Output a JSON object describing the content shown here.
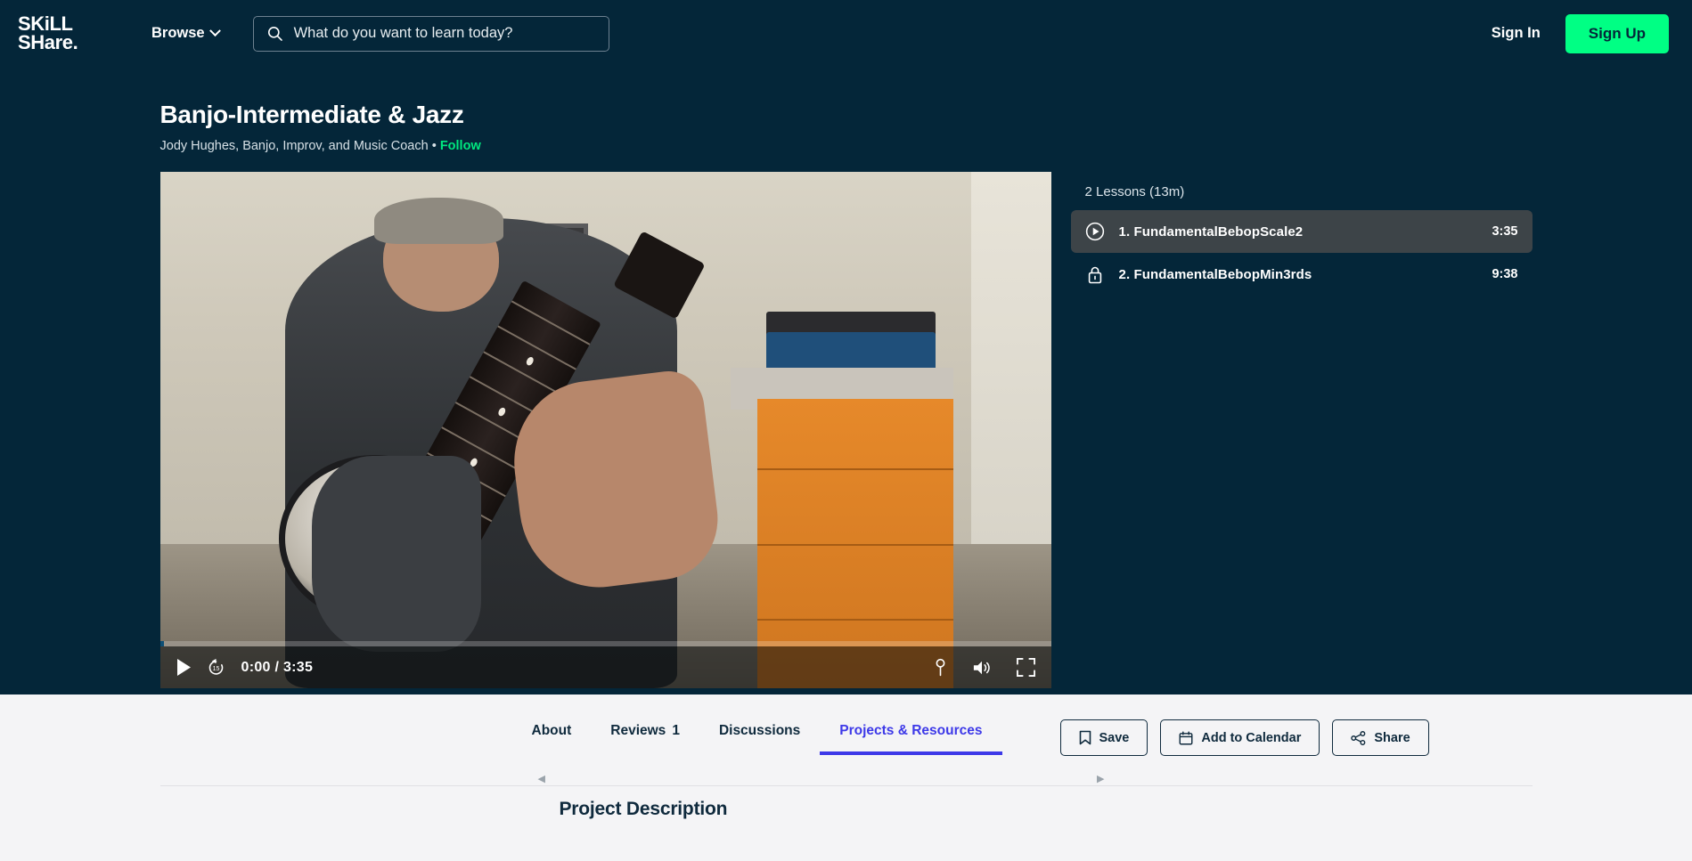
{
  "header": {
    "logo_line1": "SKiLL",
    "logo_line2": "SHare.",
    "browse_label": "Browse",
    "browse_icon": "chevron-down-icon",
    "search_icon": "search-icon",
    "search_placeholder": "What do you want to learn today?",
    "search_value": "",
    "sign_in_label": "Sign In",
    "sign_up_label": "Sign Up",
    "background_color": "#042639",
    "accent_green": "#00FF84"
  },
  "course": {
    "title": "Banjo-Intermediate & Jazz",
    "byline_author": "Jody Hughes, Banjo, Improv, and Music Coach",
    "byline_separator": "•",
    "follow_label": "Follow",
    "follow_color": "#00E87F"
  },
  "player": {
    "play_icon": "play-icon",
    "rewind_icon": "rewind-15-icon",
    "time_display": "0:00 / 3:35",
    "current_time": "0:00",
    "total_time": "3:35",
    "progress_percent": 0,
    "cc_icon": "pin-icon",
    "volume_icon": "volume-icon",
    "fullscreen_icon": "fullscreen-icon"
  },
  "lessons": {
    "summary": "2 Lessons (13m)",
    "items": [
      {
        "icon": "play-circle-icon",
        "title": "1. FundamentalBebopScale2",
        "duration": "3:35",
        "active": true
      },
      {
        "icon": "lock-icon",
        "title": "2. FundamentalBebopMin3rds",
        "duration": "9:38",
        "active": false
      }
    ]
  },
  "tabs": [
    {
      "label": "About",
      "count": "",
      "active": false
    },
    {
      "label": "Reviews",
      "count": "1",
      "active": false
    },
    {
      "label": "Discussions",
      "count": "",
      "active": false
    },
    {
      "label": "Projects & Resources",
      "count": "",
      "active": true
    }
  ],
  "actions": [
    {
      "label": "Save",
      "icon": "bookmark-icon"
    },
    {
      "label": "Add to Calendar",
      "icon": "calendar-icon"
    },
    {
      "label": "Share",
      "icon": "share-icon"
    }
  ],
  "scroller": {
    "left_arrow": "◀",
    "right_arrow": "▶"
  },
  "project": {
    "heading": "Project Description"
  },
  "colors": {
    "dark_bg": "#042639",
    "light_bg": "#f4f4f6",
    "tab_active": "#3D39E8",
    "lesson_active_bg": "#3d4448"
  }
}
